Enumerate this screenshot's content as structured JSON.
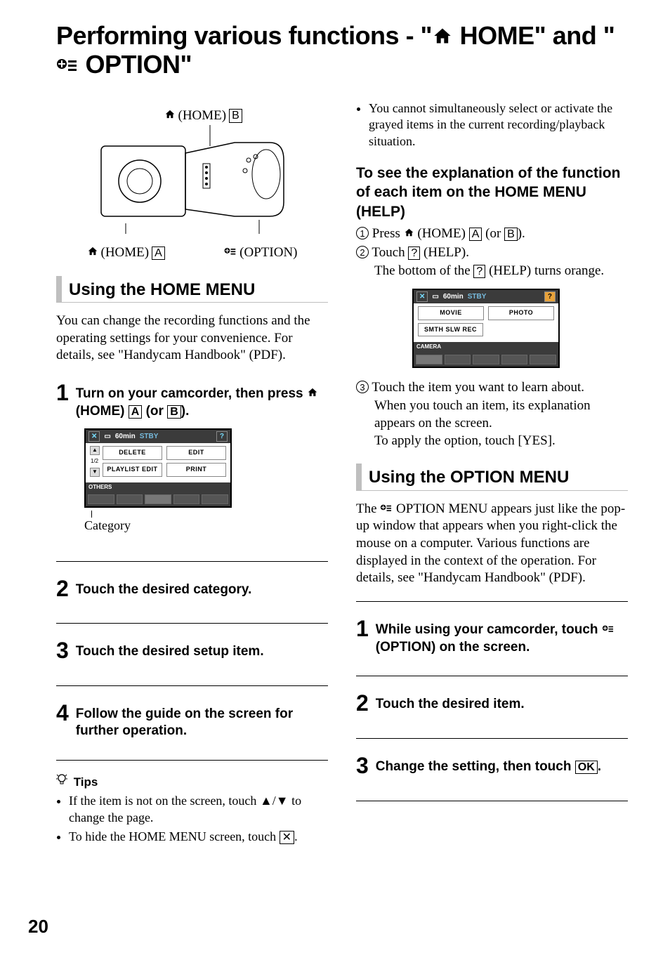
{
  "title_a": "Performing various functions - \"",
  "title_home": " HOME\" and \"",
  "title_option": " OPTION\"",
  "diagram": {
    "top": "(HOME)",
    "top_box": "B",
    "bl": "(HOME)",
    "bl_box": "A",
    "br": "(OPTION)"
  },
  "left": {
    "section": "Using the HOME MENU",
    "intro": "You can change the recording functions and the operating settings for your convenience. For details, see \"Handycam Handbook\" (PDF).",
    "step1": "Turn on your camcorder, then press ",
    "step1_b": " (HOME) ",
    "step1_c": " (or ",
    "step1_d": ").",
    "boxA": "A",
    "boxB": "B",
    "ss1": {
      "time": "60min",
      "stby": "STBY",
      "delete": "DELETE",
      "edit": "EDIT",
      "playlist": "PLAYLIST EDIT",
      "print": "PRINT",
      "page": "1/2",
      "others": "OTHERS"
    },
    "caption1": "Category",
    "step2": "Touch the desired category.",
    "step3": "Touch the desired setup item.",
    "step4": "Follow the guide on the screen for further operation.",
    "tips_hdr": "Tips",
    "tip1a": "If the item is not on the screen, touch ",
    "tip1b": " to change the page.",
    "tip2a": "To hide the HOME MENU screen, touch ",
    "tip2b": ".",
    "boxX": "✕",
    "arrows": "▲/▼"
  },
  "right": {
    "note1": "You cannot simultaneously select or activate the grayed items in the current recording/playback situation.",
    "subhead": "To see the explanation of the function of each item on the HOME MENU (HELP)",
    "s1a": "Press ",
    "s1b": " (HOME) ",
    "s1c": " (or ",
    "s1d": ").",
    "boxA": "A",
    "boxB": "B",
    "s2a": "Touch ",
    "s2b": " (HELP).",
    "boxQ": "?",
    "s2c": "The bottom of the ",
    "s2d": " (HELP) turns orange.",
    "ss2": {
      "time": "60min",
      "stby": "STBY",
      "movie": "MOVIE",
      "photo": "PHOTO",
      "smth": "SMTH SLW REC",
      "camera": "CAMERA"
    },
    "s3a": "Touch the item you want to learn about.",
    "s3b": "When you touch an item, its explanation appears on the screen.",
    "s3c": "To apply the option, touch [YES].",
    "section2": "Using the OPTION MENU",
    "intro2": "The ",
    "intro2b": " OPTION MENU appears just like the pop-up window that appears when you right-click the mouse on a computer. Various functions are displayed in the context of the operation. For details, see \"Handycam Handbook\" (PDF).",
    "ostep1a": "While using your camcorder, touch ",
    "ostep1b": " (OPTION) on the screen.",
    "ostep2": "Touch the desired item.",
    "ostep3a": "Change the setting, then touch ",
    "ostep3b": ".",
    "boxOK": "OK"
  },
  "page_number": "20"
}
